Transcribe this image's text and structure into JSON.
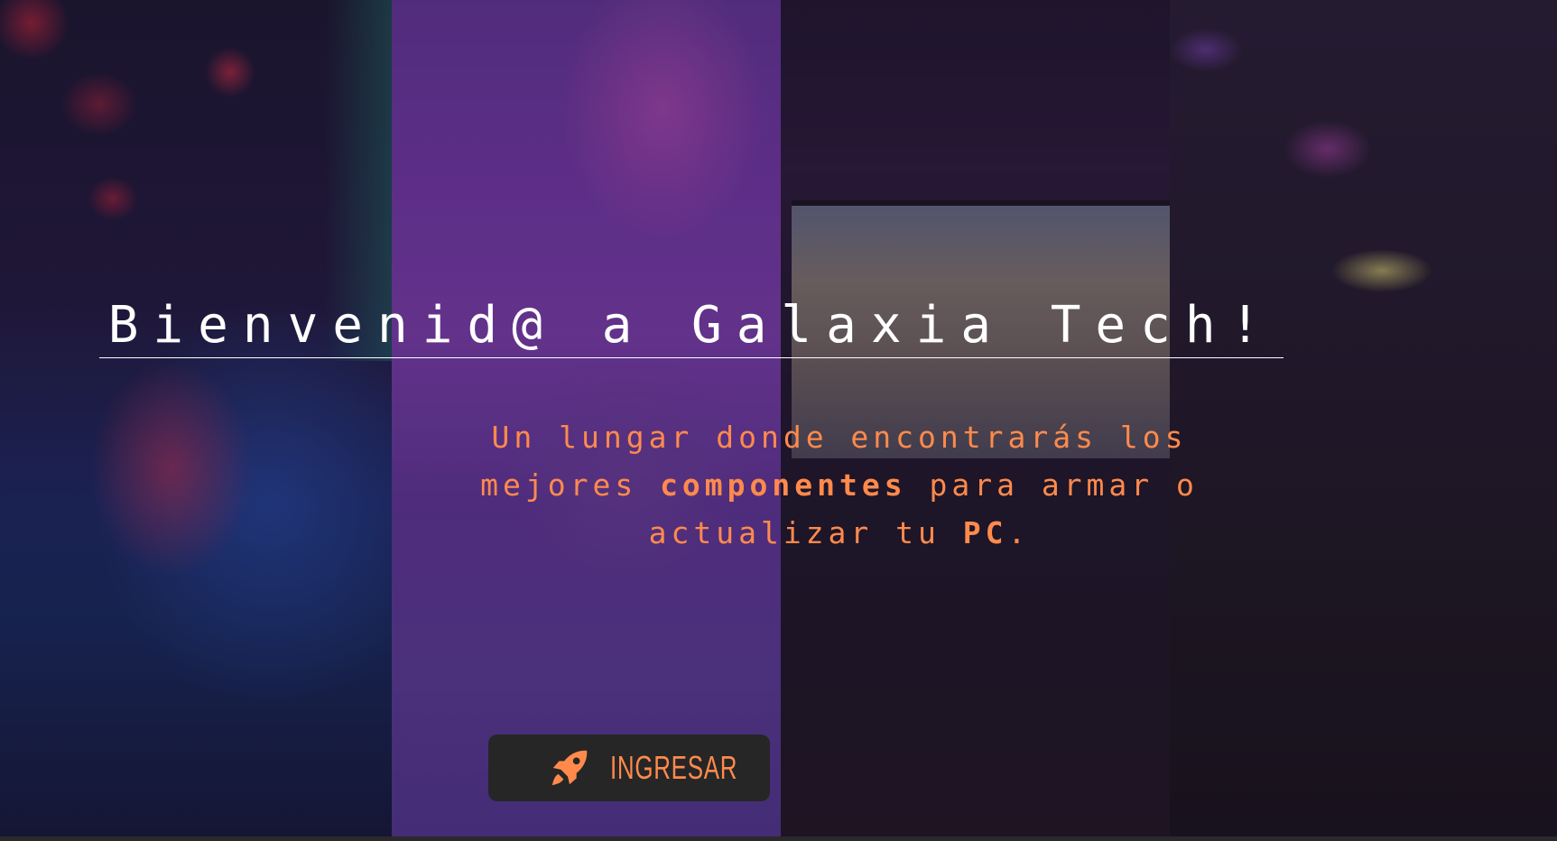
{
  "hero": {
    "title": "Bienvenid@ a Galaxia Tech!",
    "subtitle_parts": [
      "Un lungar donde encontrarás los mejores ",
      "componentes",
      " para armar o actualizar tu ",
      "PC",
      "."
    ],
    "cta_label": "INGRESAR",
    "cta_icon": "rocket-icon"
  },
  "colors": {
    "accent": "#ff8a4c",
    "title": "#ffffff",
    "button_bg": "#262626"
  }
}
